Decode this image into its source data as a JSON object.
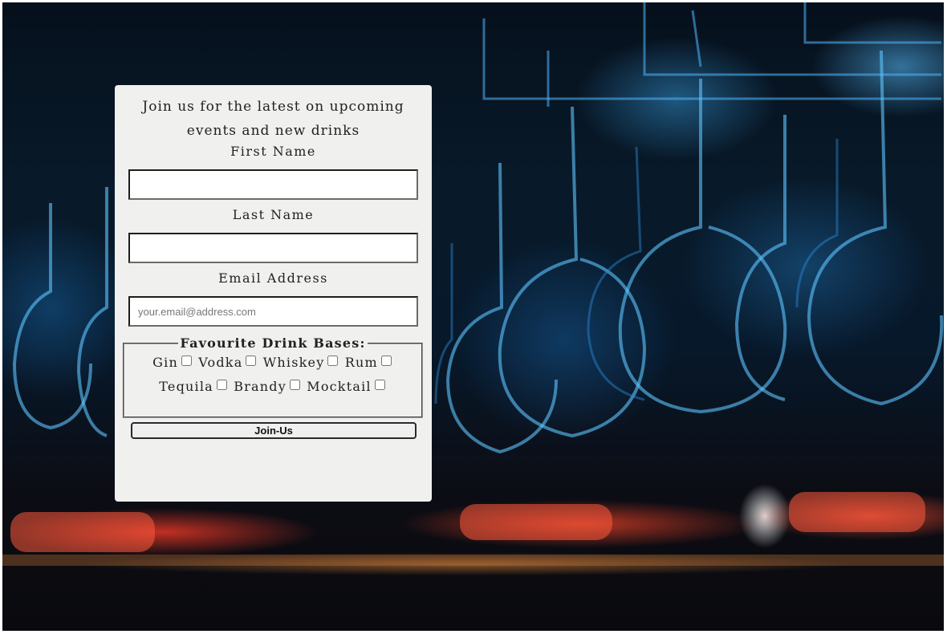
{
  "signup": {
    "intro": "Join us for the latest on upcoming events and new drinks",
    "first_name_label": "First Name",
    "first_name_value": "",
    "last_name_label": "Last Name",
    "last_name_value": "",
    "email_label": "Email Address",
    "email_value": "",
    "email_placeholder": "your.email@address.com",
    "bases_legend": "Favourite Drink Bases:",
    "options": [
      "Gin",
      "Vodka",
      "Whiskey",
      "Rum",
      "Tequila",
      "Brandy",
      "Mocktail"
    ],
    "submit_label": "Join-Us"
  },
  "colors": {
    "panel_background": "#f0f0ef",
    "text": "#222222"
  }
}
